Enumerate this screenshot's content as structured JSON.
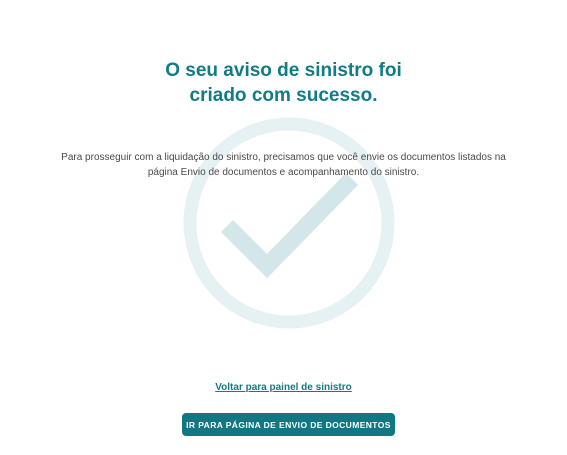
{
  "success": {
    "title_line1": "O seu aviso de sinistro foi",
    "title_line2": "criado com sucesso.",
    "message_line1": "Para prosseguir com a liquidação do sinistro, precisamos que você envie os documentos listados na",
    "message_line2": "página Envio de documentos e acompanhamento do sinistro.",
    "watermark_icon": "check-circle-icon"
  },
  "actions": {
    "back_link_label": "Voltar para painel de sinistro",
    "primary_button_label": "IR PARA PÁGINA DE ENVIO DE DOCUMENTOS"
  },
  "colors": {
    "accent": "#0f7c86",
    "button_bg": "#127782",
    "watermark": "#d6eaed"
  }
}
